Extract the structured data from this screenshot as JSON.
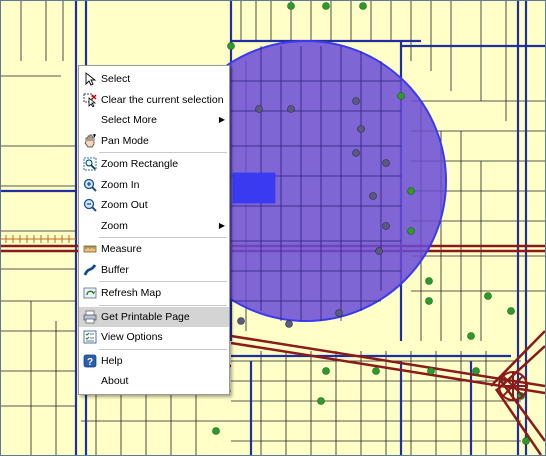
{
  "menu": {
    "items": [
      {
        "label": "Select",
        "icon": "pointer-arrow-icon"
      },
      {
        "label": "Clear the current selection",
        "icon": "clear-selection-icon"
      },
      {
        "label": "Select More",
        "submenu": true
      },
      {
        "label": "Pan Mode",
        "icon": "pan-hand-icon"
      },
      {
        "label": "Zoom Rectangle",
        "icon": "zoom-rectangle-icon"
      },
      {
        "label": "Zoom In",
        "icon": "zoom-in-icon"
      },
      {
        "label": "Zoom Out",
        "icon": "zoom-out-icon"
      },
      {
        "label": "Zoom",
        "submenu": true
      },
      {
        "label": "Measure",
        "icon": "ruler-icon"
      },
      {
        "label": "Buffer",
        "icon": "buffer-icon"
      },
      {
        "label": "Refresh Map",
        "icon": "refresh-map-icon"
      },
      {
        "label": "Get Printable Page",
        "icon": "printer-icon",
        "highlighted": true
      },
      {
        "label": "View Options",
        "icon": "view-options-icon"
      },
      {
        "label": "Help",
        "icon": "help-icon"
      },
      {
        "label": "About"
      }
    ],
    "submenu_arrow": "▶"
  },
  "colors": {
    "parcel_fill": "#ffffc8",
    "road_major": "#8b1a1a",
    "road_minor": "#1f2f9f",
    "buffer_fill": "#6a4bd6",
    "buffer_stroke": "#3a3af0",
    "node_green": "#2e9a2e",
    "menu_highlight": "#d4d4d4"
  }
}
